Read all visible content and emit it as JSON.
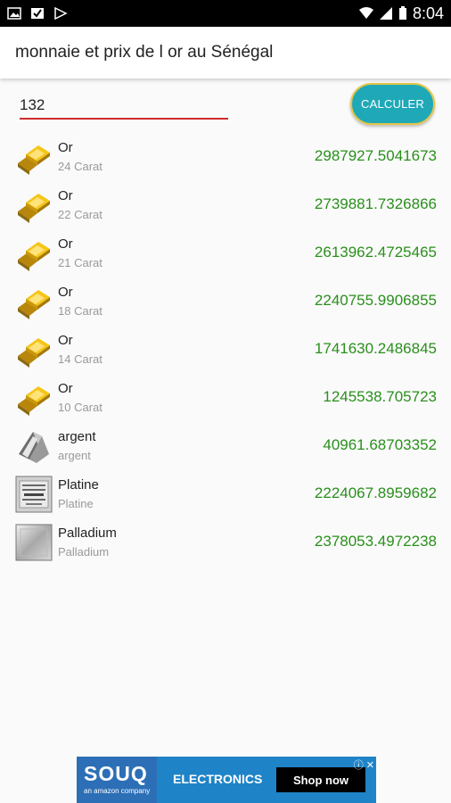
{
  "status_bar": {
    "time": "8:04",
    "icons": [
      "image-icon",
      "check-icon",
      "play-store-icon",
      "wifi-icon",
      "signal-icon",
      "battery-icon"
    ]
  },
  "app_bar": {
    "title": "monnaie et prix de l or au Sénégal"
  },
  "form": {
    "amount_value": "132",
    "calculate_label": "CALCULER"
  },
  "prices": [
    {
      "name": "Or",
      "detail": "24 Carat",
      "value": "2987927.5041673",
      "icon": "gold-bar-icon"
    },
    {
      "name": "Or",
      "detail": "22 Carat",
      "value": "2739881.7326866",
      "icon": "gold-bar-icon"
    },
    {
      "name": "Or",
      "detail": "21 Carat",
      "value": "2613962.4725465",
      "icon": "gold-bar-icon"
    },
    {
      "name": "Or",
      "detail": "18 Carat",
      "value": "2240755.9906855",
      "icon": "gold-bar-icon"
    },
    {
      "name": "Or",
      "detail": "14 Carat",
      "value": "1741630.2486845",
      "icon": "gold-bar-icon"
    },
    {
      "name": "Or",
      "detail": "10 Carat",
      "value": "1245538.705723",
      "icon": "gold-bar-icon"
    },
    {
      "name": "argent",
      "detail": "argent",
      "value": "40961.68703352",
      "icon": "silver-bar-icon"
    },
    {
      "name": "Platine",
      "detail": "Platine",
      "value": "2224067.8959682",
      "icon": "platinum-bar-icon"
    },
    {
      "name": "Palladium",
      "detail": "Palladium",
      "value": "2378053.4972238",
      "icon": "palladium-bar-icon"
    }
  ],
  "ad": {
    "brand": "SOUQ",
    "brand_sub": "an amazon company",
    "category": "ELECTRONICS",
    "cta": "Shop now",
    "close": "ⓘ ✕"
  },
  "colors": {
    "accent": "#1fa9b8",
    "value_green": "#2a8f1c",
    "input_underline": "#d02a2a"
  }
}
